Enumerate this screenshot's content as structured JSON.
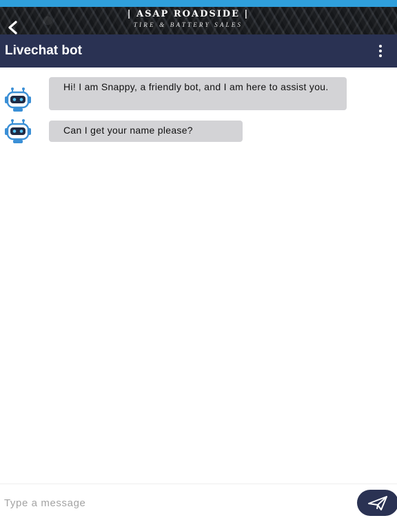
{
  "brand": {
    "name": "| ASAP ROADSIDE |",
    "tagline": "TIRE & BATTERY SALES"
  },
  "header": {
    "title": "Livechat bot"
  },
  "messages": [
    {
      "sender": "bot",
      "text": "Hi! I am Snappy, a friendly bot, and I am here to assist you."
    },
    {
      "sender": "bot",
      "text": "Can I get your name please?"
    }
  ],
  "input": {
    "placeholder": "Type a message",
    "value": ""
  },
  "icons": {
    "back": "chevron-left-icon",
    "menu": "more-vertical-icon",
    "avatar": "robot-icon",
    "send": "paper-plane-icon"
  },
  "colors": {
    "top_strip": "#2f9fdc",
    "header_bg": "#2a3253",
    "bubble_bg": "#d3d3d6",
    "robot_blue": "#3a8fd6",
    "send_button": "#2a3253"
  }
}
